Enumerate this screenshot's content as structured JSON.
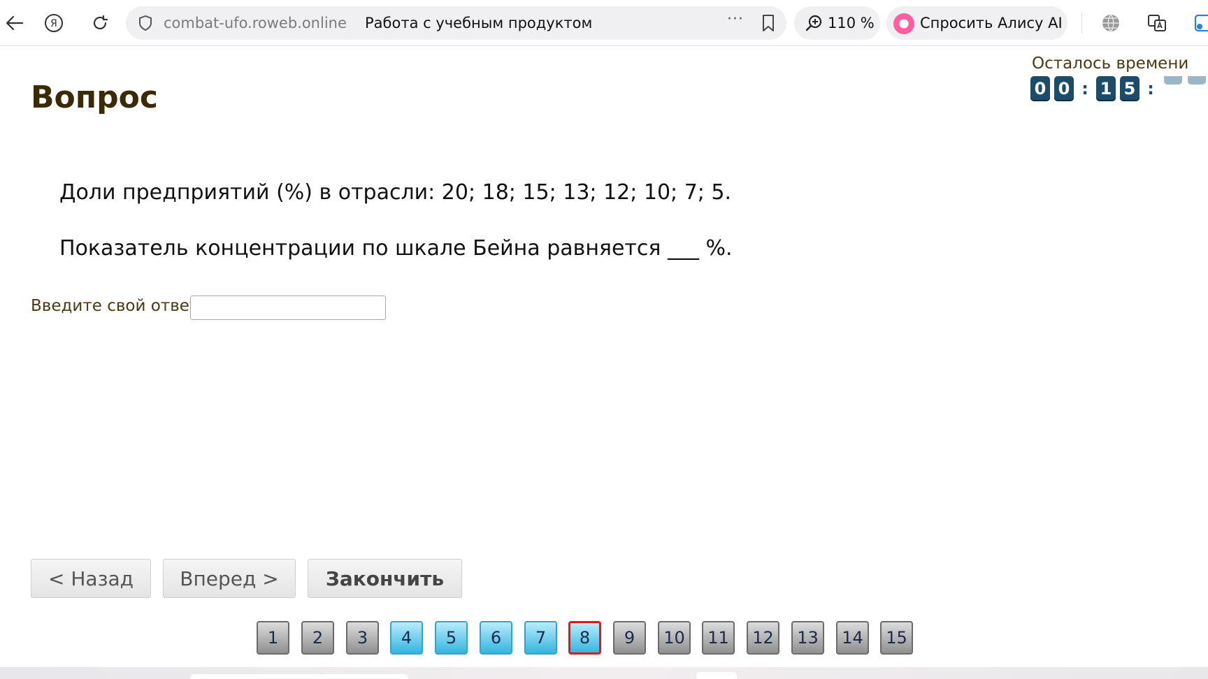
{
  "browser": {
    "domain": "combat-ufo.roweb.online",
    "page_title": "Работа с учебным продуктом",
    "zoom": "110 %",
    "alice_label": "Спросить Алису AI",
    "menu_dots": "···",
    "icons": [
      "back-arrow-icon",
      "yandex-icon",
      "reload-icon",
      "shield-icon",
      "bookmark-icon",
      "zoom-icon",
      "alice-icon",
      "globe-icon",
      "translate-icon"
    ]
  },
  "page": {
    "title": "Вопрос",
    "timer": {
      "label": "Осталось времени",
      "digits": [
        "0",
        "0",
        "1",
        "5"
      ],
      "separator": ":"
    },
    "question": {
      "line1": "Доли предприятий (%) в отрасли: 20; 18; 15; 13; 12; 10; 7; 5.",
      "line2": "Показатель концентрации по шкале Бейна равняется ___ %."
    },
    "answer": {
      "label": "Введите свой ответ",
      "value": ""
    },
    "buttons": {
      "back": "< Назад",
      "forward": "Вперед >",
      "finish": "Закончить"
    },
    "pager": {
      "items": [
        {
          "label": "1",
          "state": "normal"
        },
        {
          "label": "2",
          "state": "normal"
        },
        {
          "label": "3",
          "state": "normal"
        },
        {
          "label": "4",
          "state": "answered"
        },
        {
          "label": "5",
          "state": "answered"
        },
        {
          "label": "6",
          "state": "answered"
        },
        {
          "label": "7",
          "state": "answered"
        },
        {
          "label": "8",
          "state": "current"
        },
        {
          "label": "9",
          "state": "normal"
        },
        {
          "label": "10",
          "state": "normal"
        },
        {
          "label": "11",
          "state": "normal"
        },
        {
          "label": "12",
          "state": "normal"
        },
        {
          "label": "13",
          "state": "normal"
        },
        {
          "label": "14",
          "state": "normal"
        },
        {
          "label": "15",
          "state": "normal"
        }
      ]
    }
  },
  "colors": {
    "title": "#3a2a06",
    "timer_digit_bg": "#1b4d6b",
    "answered_tab": "#36b5e0",
    "current_border": "#e01818"
  }
}
